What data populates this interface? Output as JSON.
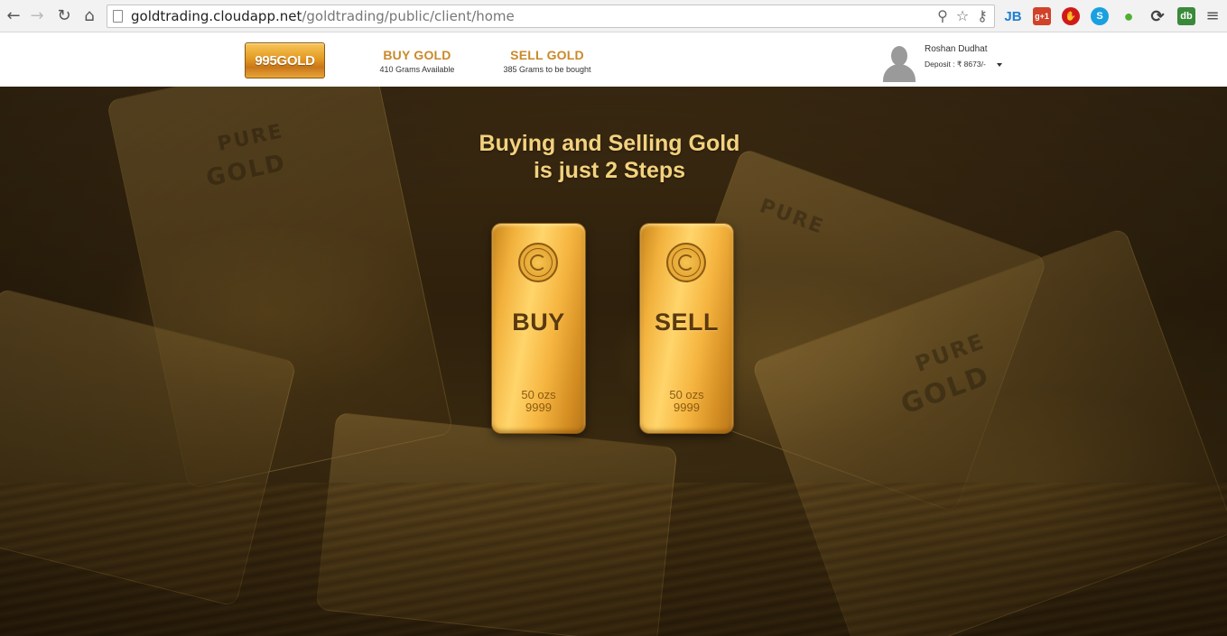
{
  "browser": {
    "url_host": "goldtrading.cloudapp.net",
    "url_path": "/goldtrading/public/client/home",
    "icons": [
      "back-arrow-icon",
      "forward-arrow-icon",
      "reload-icon",
      "home-icon",
      "page-icon",
      "zoom-icon",
      "star-icon",
      "key-icon",
      "menu-icon"
    ],
    "extensions": [
      {
        "name": "jb-extension-icon",
        "label": "JB",
        "color": "#1e7fd0"
      },
      {
        "name": "google-plus-extension-icon",
        "label": "g+1",
        "color": "#d0422a"
      },
      {
        "name": "stop-extension-icon",
        "label": "✋",
        "color": "#d01a1a"
      },
      {
        "name": "skype-extension-icon",
        "label": "S",
        "color": "#1aa0e0"
      },
      {
        "name": "evernote-extension-icon",
        "label": "●",
        "color": "#4fb030"
      },
      {
        "name": "sync-extension-icon",
        "label": "⟳",
        "color": "#444444"
      },
      {
        "name": "db-extension-icon",
        "label": "db",
        "color": "#3a8a3a"
      }
    ]
  },
  "header": {
    "logo": "995GOLD",
    "buy": {
      "label": "BUY GOLD",
      "sub": "410 Grams Available"
    },
    "sell": {
      "label": "SELL GOLD",
      "sub": "385 Grams to be bought"
    },
    "user": {
      "name": "Roshan Dudhat",
      "deposit": "Deposit : ₹ 8673/-"
    }
  },
  "hero": {
    "title_line1": "Buying and Selling Gold",
    "title_line2": "is just 2 Steps",
    "buy_bar": {
      "label": "BUY",
      "weight": "50 ozs",
      "purity": "9999"
    },
    "sell_bar": {
      "label": "SELL",
      "weight": "50 ozs",
      "purity": "9999"
    }
  },
  "colors": {
    "accent_gold": "#c9892a",
    "title_gold": "#f3d27e",
    "bar_text": "#5b3a0e"
  }
}
